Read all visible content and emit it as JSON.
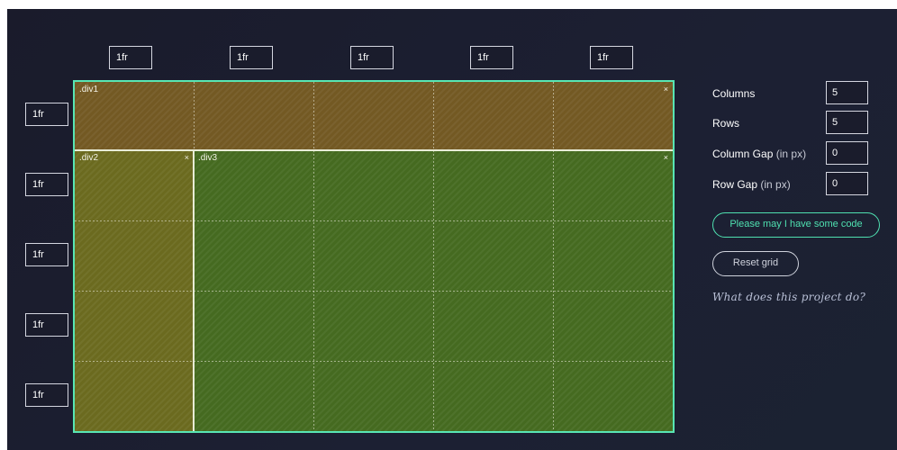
{
  "column_tracks": [
    "1fr",
    "1fr",
    "1fr",
    "1fr",
    "1fr"
  ],
  "row_tracks": [
    "1fr",
    "1fr",
    "1fr",
    "1fr",
    "1fr"
  ],
  "areas": [
    {
      "name": ".div1",
      "close": "×",
      "color": "#735923"
    },
    {
      "name": ".div2",
      "close": "×",
      "color": "#6b6a1f"
    },
    {
      "name": ".div3",
      "close": "×",
      "color": "#456a20"
    }
  ],
  "controls": {
    "columns": {
      "label": "Columns",
      "value": "5"
    },
    "rows": {
      "label": "Rows",
      "value": "5"
    },
    "column_gap": {
      "label": "Column Gap",
      "unit": "(in px)",
      "value": "0"
    },
    "row_gap": {
      "label": "Row Gap",
      "unit": "(in px)",
      "value": "0"
    }
  },
  "buttons": {
    "code": "Please may I have some code",
    "reset": "Reset grid"
  },
  "about_link": "What does this project do?",
  "colors": {
    "accent": "#4fe0b0",
    "grid_border": "#58e6b3",
    "background": "#1b1e2f"
  }
}
